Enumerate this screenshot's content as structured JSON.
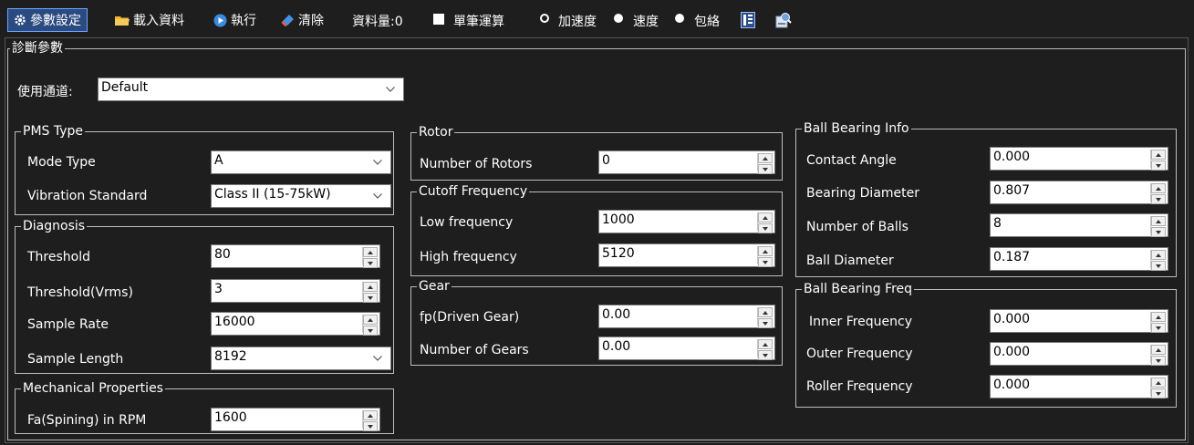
{
  "toolbar": {
    "params_label": "參數設定",
    "load_label": "載入資料",
    "run_label": "執行",
    "clear_label": "清除",
    "data_count_text": "資料量:0",
    "single_calc_label": "單筆運算",
    "radio_accel_label": "加速度",
    "radio_velocity_label": "速度",
    "radio_envelope_label": "包絡",
    "selected_mode": "加速度"
  },
  "diag_params": {
    "title": "診斷參數",
    "channel_label": "使用通道:",
    "channel_value": "Default"
  },
  "pms_type": {
    "title": "PMS Type",
    "mode_type_label": "Mode Type",
    "mode_type_value": "A",
    "vibration_label": "Vibration Standard",
    "vibration_value": "Class II (15-75kW)"
  },
  "diagnosis": {
    "title": "Diagnosis",
    "threshold_label": "Threshold",
    "threshold_value": "80",
    "threshold_vrms_label": "Threshold(Vrms)",
    "threshold_vrms_value": "3",
    "sample_rate_label": "Sample Rate",
    "sample_rate_value": "16000",
    "sample_length_label": "Sample Length",
    "sample_length_value": "8192"
  },
  "mechanical": {
    "title": "Mechanical Properties",
    "fa_label": "Fa(Spining) in RPM",
    "fa_value": "1600"
  },
  "rotor": {
    "title": "Rotor",
    "num_rotors_label": "Number of Rotors",
    "num_rotors_value": "0"
  },
  "cutoff": {
    "title": "Cutoff Frequency",
    "low_label": "Low frequency",
    "low_value": "1000",
    "high_label": "High frequency",
    "high_value": "5120"
  },
  "gear": {
    "title": "Gear",
    "fp_label": "fp(Driven Gear)",
    "fp_value": "0.00",
    "num_gears_label": "Number of Gears",
    "num_gears_value": "0.00"
  },
  "bearing_info": {
    "title": "Ball Bearing Info",
    "contact_angle_label": "Contact Angle",
    "contact_angle_value": "0.000",
    "bearing_diameter_label": "Bearing Diameter",
    "bearing_diameter_value": "0.807",
    "num_balls_label": "Number of Balls",
    "num_balls_value": "8",
    "ball_diameter_label": "Ball Diameter",
    "ball_diameter_value": "0.187"
  },
  "bearing_freq": {
    "title": "Ball Bearing Freq",
    "inner_label": "Inner Frequency",
    "inner_value": "0.000",
    "outer_label": "Outer Frequency",
    "outer_value": "0.000",
    "roller_label": "Roller Frequency",
    "roller_value": "0.000"
  },
  "colors": {
    "background": "#1e1e1e",
    "border": "#bdbdbd",
    "active_button": "#2a4a80",
    "input_bg": "#ffffff"
  },
  "icons": {
    "params": "gear-icon",
    "load": "folder-icon",
    "run": "play-icon",
    "clear": "eraser-icon",
    "table": "table-icon",
    "report": "report-icon"
  }
}
